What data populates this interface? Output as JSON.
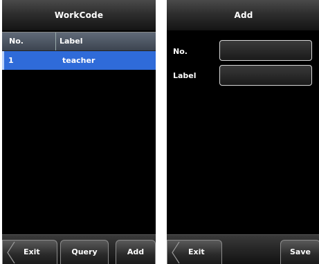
{
  "workcode_screen": {
    "title": "WorkCode",
    "columns": [
      "No.",
      "Label"
    ],
    "rows": [
      {
        "no": "1",
        "label": "teacher"
      }
    ],
    "buttons": {
      "exit": "Exit",
      "query": "Query",
      "add": "Add"
    }
  },
  "add_screen": {
    "title": "Add",
    "fields": {
      "no_label": "No.",
      "no_value": "",
      "label_label": "Label",
      "label_value": ""
    },
    "buttons": {
      "exit": "Exit",
      "save": "Save"
    }
  },
  "colors": {
    "selection": "#2f6bd9",
    "background": "#000000"
  }
}
